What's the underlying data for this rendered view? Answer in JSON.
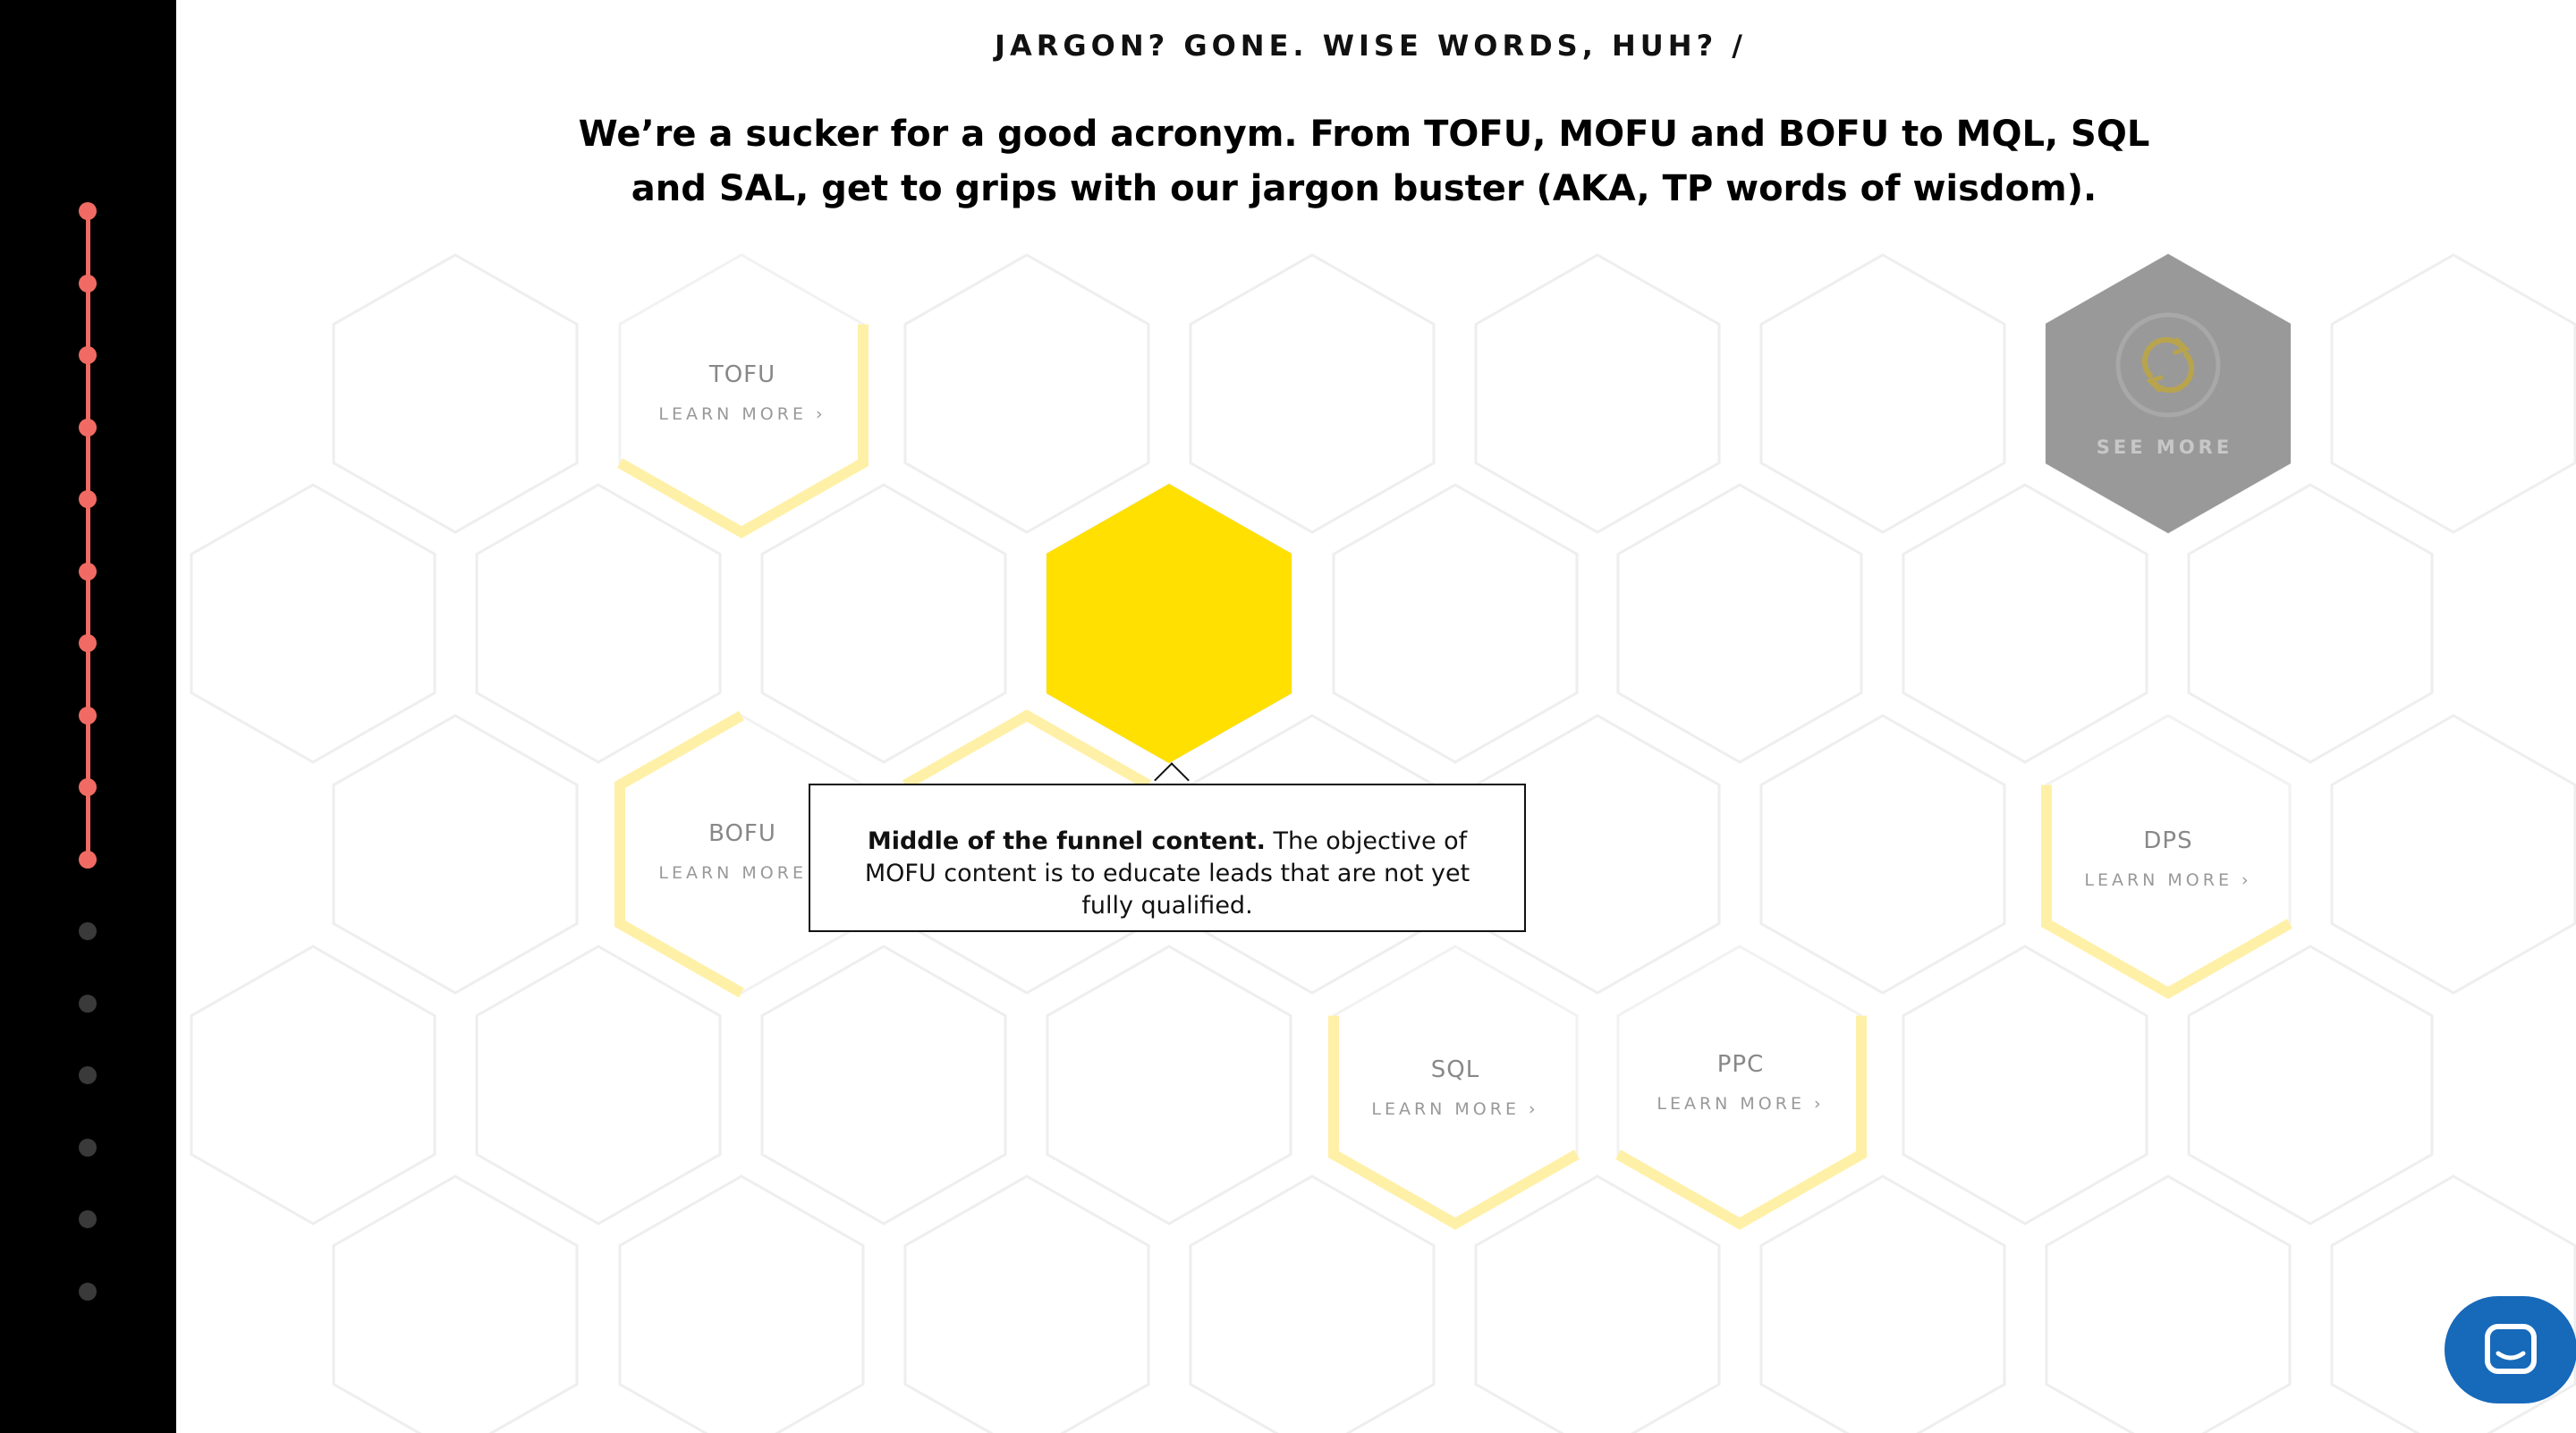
{
  "section": {
    "heading": "JARGON? GONE. WISE WORDS, HUH? /",
    "intro": "We’re a sucker for a good acronym. From TOFU, MOFU and BOFU to MQL, SQL and SAL, get to grips with our jargon buster (AKA, TP words of wisdom)."
  },
  "terms": [
    {
      "term": "TOFU",
      "link": "LEARN MORE ›"
    },
    {
      "term": "BOFU",
      "link": "LEARN MORE ›"
    },
    {
      "term": "DPS",
      "link": "LEARN MORE ›"
    },
    {
      "term": "SQL",
      "link": "LEARN MORE ›"
    },
    {
      "term": "PPC",
      "link": "LEARN MORE ›"
    }
  ],
  "see_more": {
    "label": "SEE MORE",
    "icon": "refresh-icon"
  },
  "tooltip": {
    "title": "Middle of the funnel content.",
    "body": " The objective of MOFU content is to educate leads that are not yet fully qualified."
  },
  "sidebar": {
    "active_count": 10,
    "inactive_count": 6,
    "accent": "#f06b64"
  },
  "chat": {
    "icon": "chat-icon",
    "color": "#1769ba"
  },
  "colors": {
    "highlight": "#ffe000",
    "highlight_soft": "#fff0a8",
    "see_more_bg": "#999999"
  }
}
